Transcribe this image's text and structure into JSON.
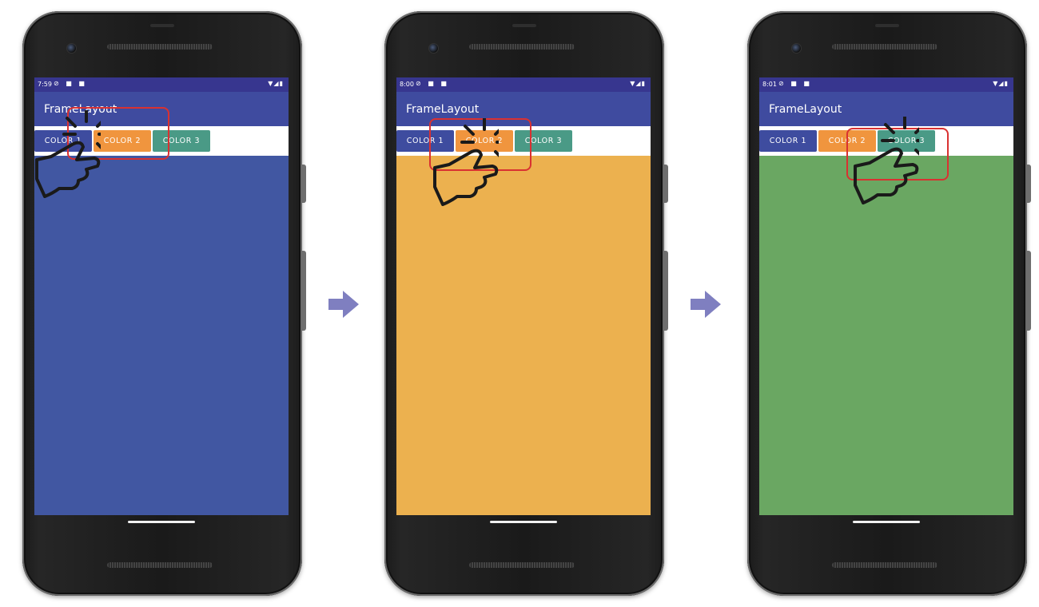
{
  "colors": {
    "status_bar": "#37368f",
    "app_bar": "#3f4b9f",
    "color1": "#3e4c9f",
    "color2": "#f0953e",
    "color3": "#4a9a86",
    "content_blue": "#4157a2",
    "content_orange": "#ecb14f",
    "content_green": "#6aa762",
    "highlight": "#d93131",
    "arrow": "#7f7fc0"
  },
  "phones": [
    {
      "time": "7:59",
      "app_title": "FrameLayout",
      "buttons": [
        "COLOR 1",
        "COLOR 2",
        "COLOR 3"
      ],
      "content_color": "blue",
      "tapped_button": "COLOR 1"
    },
    {
      "time": "8:00",
      "app_title": "FrameLayout",
      "buttons": [
        "COLOR 1",
        "COLOR 2",
        "COLOR 3"
      ],
      "content_color": "orange",
      "tapped_button": "COLOR 2"
    },
    {
      "time": "8:01",
      "app_title": "FrameLayout",
      "buttons": [
        "COLOR 1",
        "COLOR 2",
        "COLOR 3"
      ],
      "content_color": "green",
      "tapped_button": "COLOR 3"
    }
  ],
  "icons": [
    "hand-tap-icon",
    "arrow-right-icon",
    "wifi-icon",
    "signal-icon",
    "battery-icon"
  ]
}
